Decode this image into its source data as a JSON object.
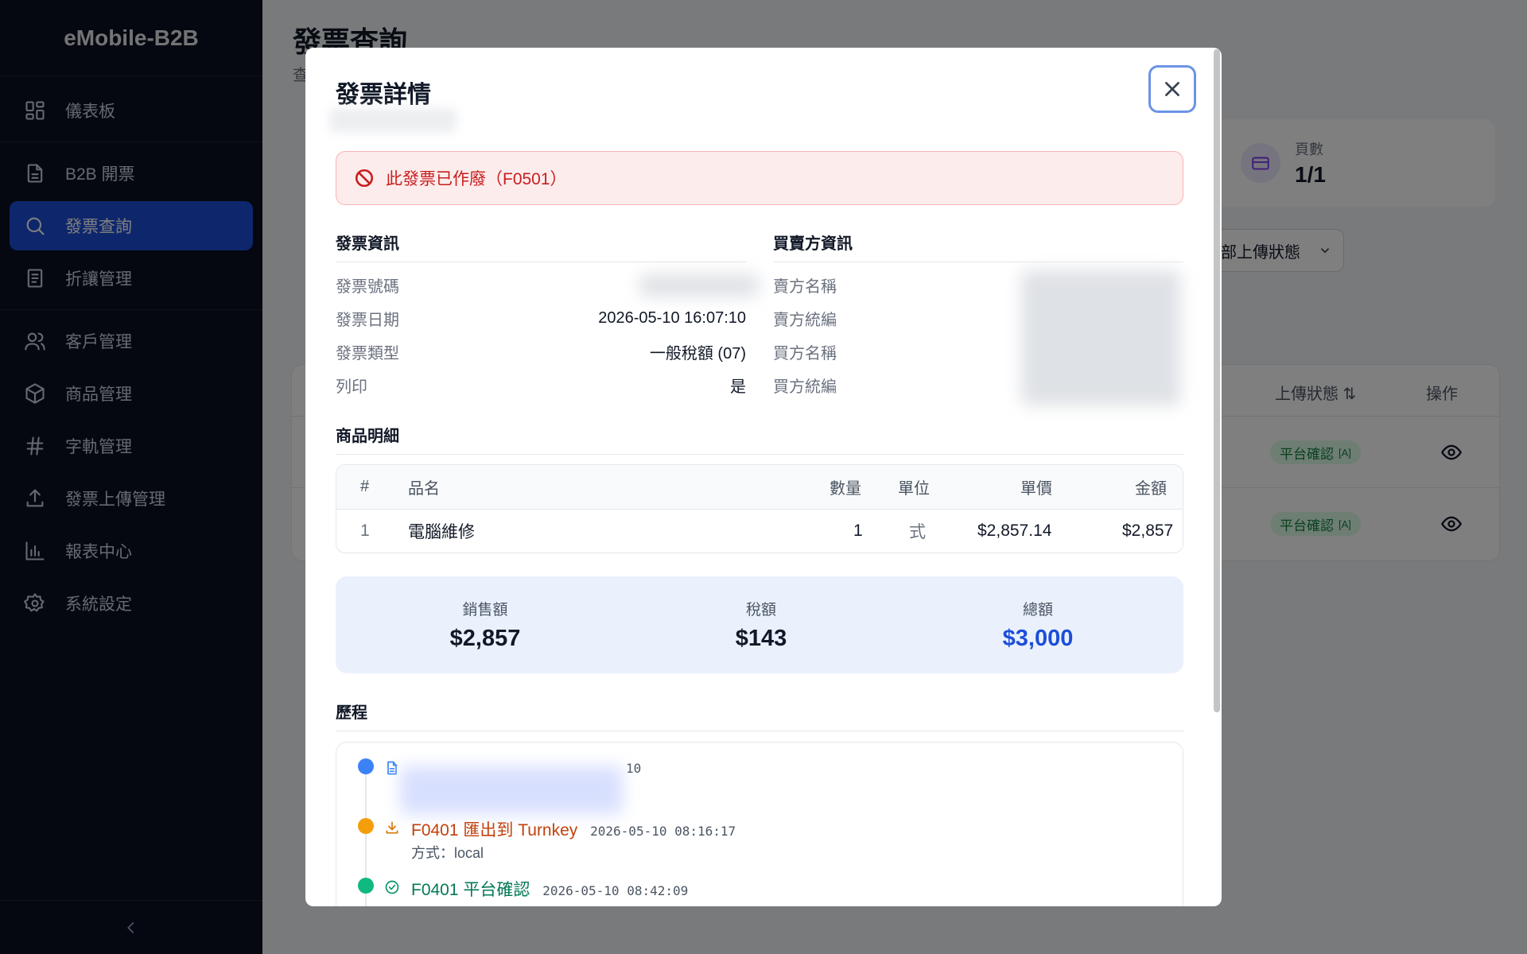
{
  "app": {
    "brand": "eMobile-B2B"
  },
  "sidebar": {
    "items": [
      {
        "label": "儀表板",
        "icon": "dashboard-icon"
      },
      {
        "label": "B2B 開票",
        "icon": "document-icon"
      },
      {
        "label": "發票查詢",
        "icon": "search-icon",
        "active": true
      },
      {
        "label": "折讓管理",
        "icon": "receipt-icon"
      },
      {
        "label": "客戶管理",
        "icon": "users-icon"
      },
      {
        "label": "商品管理",
        "icon": "box-icon"
      },
      {
        "label": "字軌管理",
        "icon": "hash-icon"
      },
      {
        "label": "發票上傳管理",
        "icon": "upload-icon"
      },
      {
        "label": "報表中心",
        "icon": "bar-chart-icon"
      },
      {
        "label": "系統設定",
        "icon": "gear-icon"
      }
    ]
  },
  "page": {
    "title": "發票查詢",
    "subtitle": "查",
    "stat": {
      "label": "頁數",
      "value": "1/1"
    },
    "filter_status": "部上傳狀態",
    "table": {
      "col_status": "上傳狀態 ⇅",
      "col_action": "操作",
      "rows": [
        {
          "status": "平台確認",
          "tag": "[A]"
        },
        {
          "status": "平台確認",
          "tag": "[A]"
        }
      ]
    }
  },
  "modal": {
    "title": "發票詳情",
    "alert": "此發票已作廢（F0501）",
    "invoice_info": {
      "heading": "發票資訊",
      "fields": [
        {
          "label": "發票號碼",
          "value": ""
        },
        {
          "label": "發票日期",
          "value": "2026-05-10 16:07:10"
        },
        {
          "label": "發票類型",
          "value": "一般稅額 (07)"
        },
        {
          "label": "列印",
          "value": "是"
        }
      ]
    },
    "party_info": {
      "heading": "買賣方資訊",
      "fields": [
        {
          "label": "賣方名稱"
        },
        {
          "label": "賣方統編"
        },
        {
          "label": "買方名稱"
        },
        {
          "label": "買方統編"
        }
      ]
    },
    "items": {
      "heading": "商品明細",
      "columns": [
        "#",
        "品名",
        "數量",
        "單位",
        "單價",
        "金額"
      ],
      "rows": [
        {
          "no": "1",
          "name": "電腦維修",
          "qty": "1",
          "unit": "式",
          "price": "$2,857.14",
          "amount": "$2,857"
        }
      ]
    },
    "totals": {
      "sales_label": "銷售額",
      "sales": "$2,857",
      "tax_label": "稅額",
      "tax": "$143",
      "total_label": "總額",
      "total": "$3,000"
    },
    "history": {
      "heading": "歷程",
      "events": [
        {
          "title": "",
          "time": "10",
          "color": "#3b82f6"
        },
        {
          "title": "F0401 匯出到 Turnkey",
          "time": "2026-05-10 08:16:17",
          "sub": "方式：local",
          "color": "#f59e0b"
        },
        {
          "title": "F0401 平台確認",
          "time": "2026-05-10 08:42:09",
          "color": "#10b981"
        }
      ]
    }
  }
}
